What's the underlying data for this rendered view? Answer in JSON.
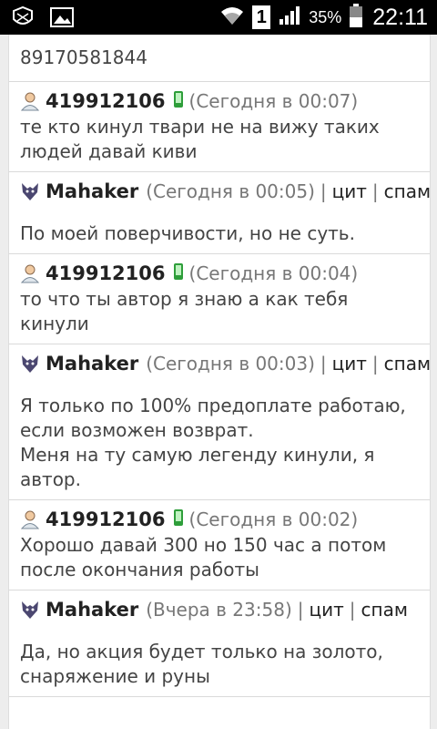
{
  "status_bar": {
    "battery_percent": "35%",
    "clock": "22:11",
    "sim_label": "1",
    "icons": [
      "shield-icon",
      "image-icon",
      "wifi-icon",
      "sim-card-icon",
      "signal-icon",
      "battery-icon"
    ]
  },
  "feed": {
    "first_line": "89170581844",
    "messages": [
      {
        "type": "user",
        "author": "419912106",
        "time": "(Сегодня в 00:07)",
        "text": "те кто кинул твари не на вижу таких людей давай киви"
      },
      {
        "type": "mod",
        "author": "Mahaker",
        "time": "(Сегодня в 00:05)",
        "quote_label": "цит",
        "spam_label": "спам",
        "text": "По моей поверчивости, но не суть."
      },
      {
        "type": "user",
        "author": "419912106",
        "time": "(Сегодня в 00:04)",
        "text": "то что ты автор я знаю а как тебя кинули"
      },
      {
        "type": "mod",
        "author": "Mahaker",
        "time": "(Сегодня в 00:03)",
        "quote_label": "цит",
        "spam_label": "спам",
        "text_lines": [
          "Я только по 100% предоплате работаю, если возможен возврат.",
          "Меня на ту самую легенду кинули, я автор."
        ]
      },
      {
        "type": "user",
        "author": "419912106",
        "time": "(Сегодня в 00:02)",
        "text": "Хорошо давай 300 но 150 час а потом после окончания работы"
      },
      {
        "type": "mod",
        "author": "Mahaker",
        "time": "(Вчера в 23:58)",
        "quote_label": "цит",
        "spam_label": "спам",
        "text": "Да, но акция будет только на золото, снаряжение и руны"
      }
    ]
  },
  "colors": {
    "status_bar_bg": "#000000",
    "page_bg": "#ededed",
    "card_bg": "#ffffff",
    "phone_green": "#2e9e3a",
    "wolf_purple": "#4b4770"
  }
}
